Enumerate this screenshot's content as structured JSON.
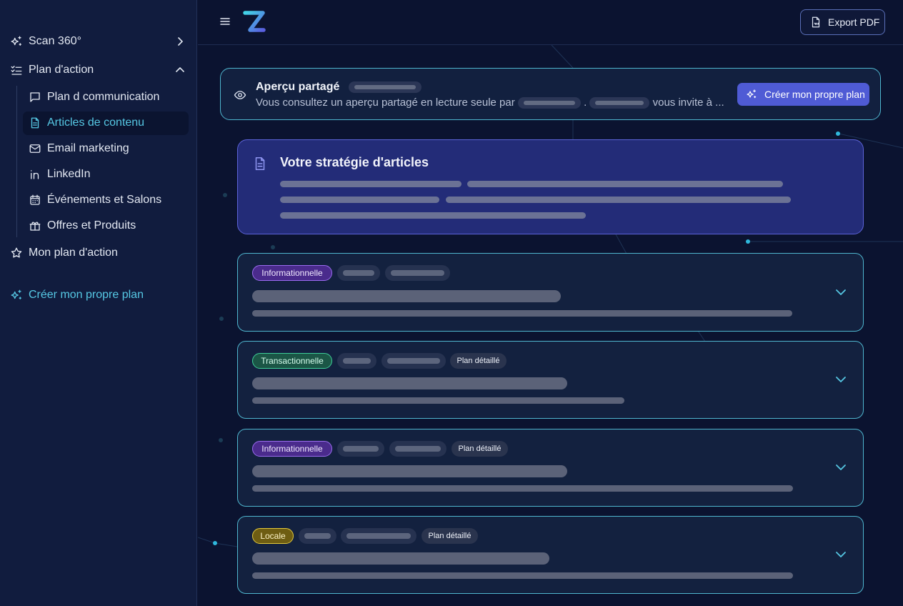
{
  "sidebar": {
    "items": [
      {
        "label": "Scan 360°",
        "icon": "sparkles-icon"
      },
      {
        "label": "Plan d'action",
        "icon": "checklist-icon"
      },
      {
        "label": "Mon plan d'action",
        "icon": "star-icon"
      },
      {
        "label": "Créer mon propre plan",
        "icon": "sparkles-icon"
      }
    ],
    "subitems": [
      {
        "label": "Plan d communication",
        "icon": "message-square-icon"
      },
      {
        "label": "Articles de contenu",
        "icon": "file-text-icon",
        "active": true
      },
      {
        "label": "Email marketing",
        "icon": "mail-icon"
      },
      {
        "label": "LinkedIn",
        "icon": "linkedin-icon"
      },
      {
        "label": "Événements et Salons",
        "icon": "calendar-icon"
      },
      {
        "label": "Offres et Produits",
        "icon": "gift-icon"
      }
    ]
  },
  "header": {
    "export_label": "Export PDF"
  },
  "shared_banner": {
    "title": "Aperçu partagé",
    "text_before": "Vous consultez un aperçu partagé en lecture seule par",
    "separator": ".",
    "text_after": "vous invite à ...",
    "button_label": "Créer mon propre plan"
  },
  "strategy": {
    "title": "Votre stratégie d'articles"
  },
  "articles": [
    {
      "tag": "Informationnelle",
      "tag_type": "info",
      "plan_label": ""
    },
    {
      "tag": "Transactionnelle",
      "tag_type": "trans",
      "plan_label": "Plan détaillé"
    },
    {
      "tag": "Informationnelle",
      "tag_type": "info",
      "plan_label": "Plan détaillé"
    },
    {
      "tag": "Locale",
      "tag_type": "local",
      "plan_label": "Plan détaillé"
    }
  ],
  "colors": {
    "accent": "#56c8e4",
    "primary_button": "#4f5bd5",
    "card_border": "#4fb6cf"
  }
}
